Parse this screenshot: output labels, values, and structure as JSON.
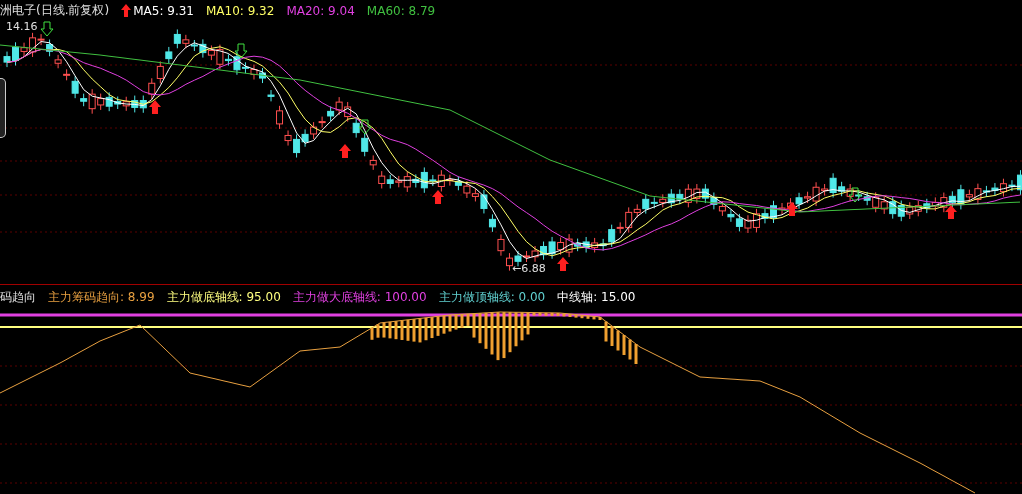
{
  "price_panel": {
    "title": "洲电子(日线.前复权)",
    "legend": [
      {
        "label": "MA5: 9.31",
        "color": "#ffffff"
      },
      {
        "label": "MA10: 9.32",
        "color": "#ffff66"
      },
      {
        "label": "MA20: 9.04",
        "color": "#e040e0"
      },
      {
        "label": "MA60: 8.79",
        "color": "#40c040"
      }
    ],
    "high_label": "14.16",
    "low_label": "←6.88"
  },
  "indicator_panel": {
    "title": "码趋向",
    "legend": [
      {
        "label": "主力筹码趋向: 8.99",
        "color": "#e8a040"
      },
      {
        "label": "主力做底轴线: 95.00",
        "color": "#ffff80"
      },
      {
        "label": "主力做大底轴线: 100.00",
        "color": "#e040e0"
      },
      {
        "label": "主力做顶轴线: 0.00",
        "color": "#60d0d0"
      },
      {
        "label": "中线轴: 15.00",
        "color": "#ffffff"
      }
    ]
  }
}
